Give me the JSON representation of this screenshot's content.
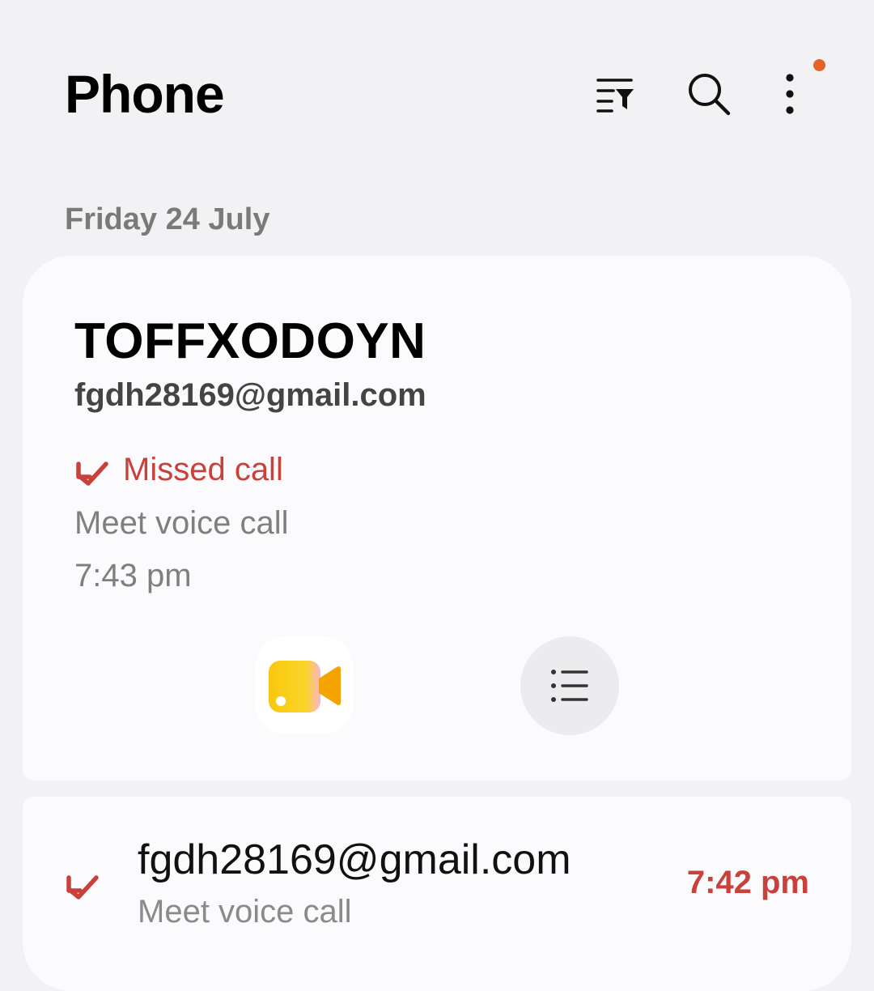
{
  "header": {
    "title": "Phone",
    "icons": [
      "filter-icon",
      "search-icon",
      "more-options-icon"
    ],
    "notification_dot_color": "#e2642a"
  },
  "call_log": {
    "date_heading": "Friday 24 July",
    "expanded_entry": {
      "name": "TOFFXODOYN",
      "email": "fgdh28169@gmail.com",
      "status": "Missed call",
      "call_type": "Meet voice call",
      "time": "7:43 pm",
      "actions": [
        "meet-video-call",
        "call-details"
      ]
    },
    "entries": [
      {
        "email": "fgdh28169@gmail.com",
        "call_type": "Meet voice call",
        "time": "7:42 pm",
        "status_icon": "missed-call-icon"
      }
    ]
  },
  "colors": {
    "missed": "#c8413a",
    "background": "#f2f2f4",
    "card": "#fbfbfd"
  }
}
